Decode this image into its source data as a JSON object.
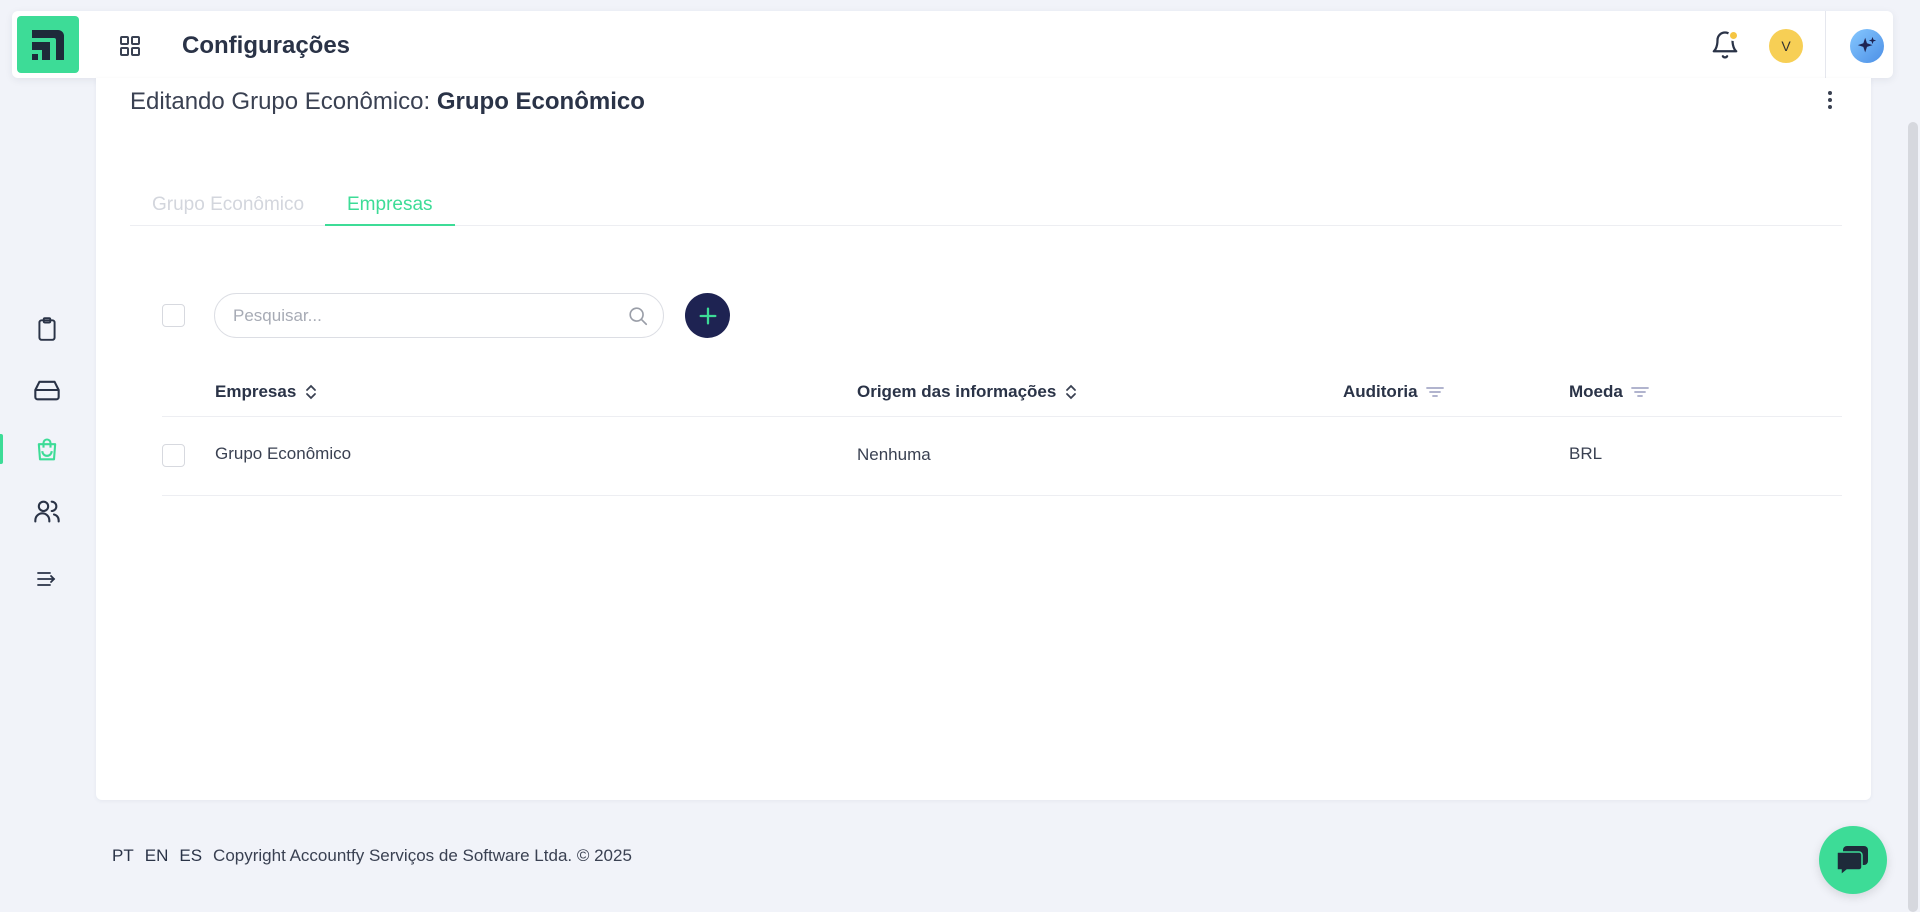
{
  "header": {
    "title": "Configurações",
    "user_initial": "V",
    "icons": {
      "logo": "logo-icon",
      "apps": "apps-grid-icon",
      "notifications": "bell-icon",
      "assistant": "sparkles-icon"
    }
  },
  "sidebar": {
    "items": [
      {
        "name": "clipboard",
        "icon": "clipboard-icon",
        "active": false
      },
      {
        "name": "storage",
        "icon": "hard-drive-icon",
        "active": false
      },
      {
        "name": "shopping",
        "icon": "shopping-bag-icon",
        "active": true
      },
      {
        "name": "users",
        "icon": "users-icon",
        "active": false
      },
      {
        "name": "menu",
        "icon": "list-arrow-icon",
        "active": false
      }
    ]
  },
  "main": {
    "edit_prefix": "Editando Grupo Econômico:",
    "edit_name": "Grupo Econômico",
    "tabs": [
      {
        "label": "Grupo Econômico",
        "active": false
      },
      {
        "label": "Empresas",
        "active": true
      }
    ],
    "search": {
      "placeholder": "Pesquisar...",
      "value": ""
    },
    "table": {
      "columns": [
        {
          "label": "Empresas",
          "control": "sort"
        },
        {
          "label": "Origem das informações",
          "control": "sort"
        },
        {
          "label": "Auditoria",
          "control": "filter"
        },
        {
          "label": "Moeda",
          "control": "filter"
        }
      ],
      "rows": [
        {
          "empresa": "Grupo Econômico",
          "origem": "Nenhuma",
          "auditoria": "",
          "moeda": "BRL"
        }
      ]
    }
  },
  "footer": {
    "languages": [
      "PT",
      "EN",
      "ES"
    ],
    "copyright": "Copyright Accountfy Serviços de Software Ltda. © 2025"
  },
  "colors": {
    "accent": "#3ddc97",
    "primary_dark": "#1e2352",
    "avatar": "#f7cf55",
    "text": "#2a3347"
  }
}
